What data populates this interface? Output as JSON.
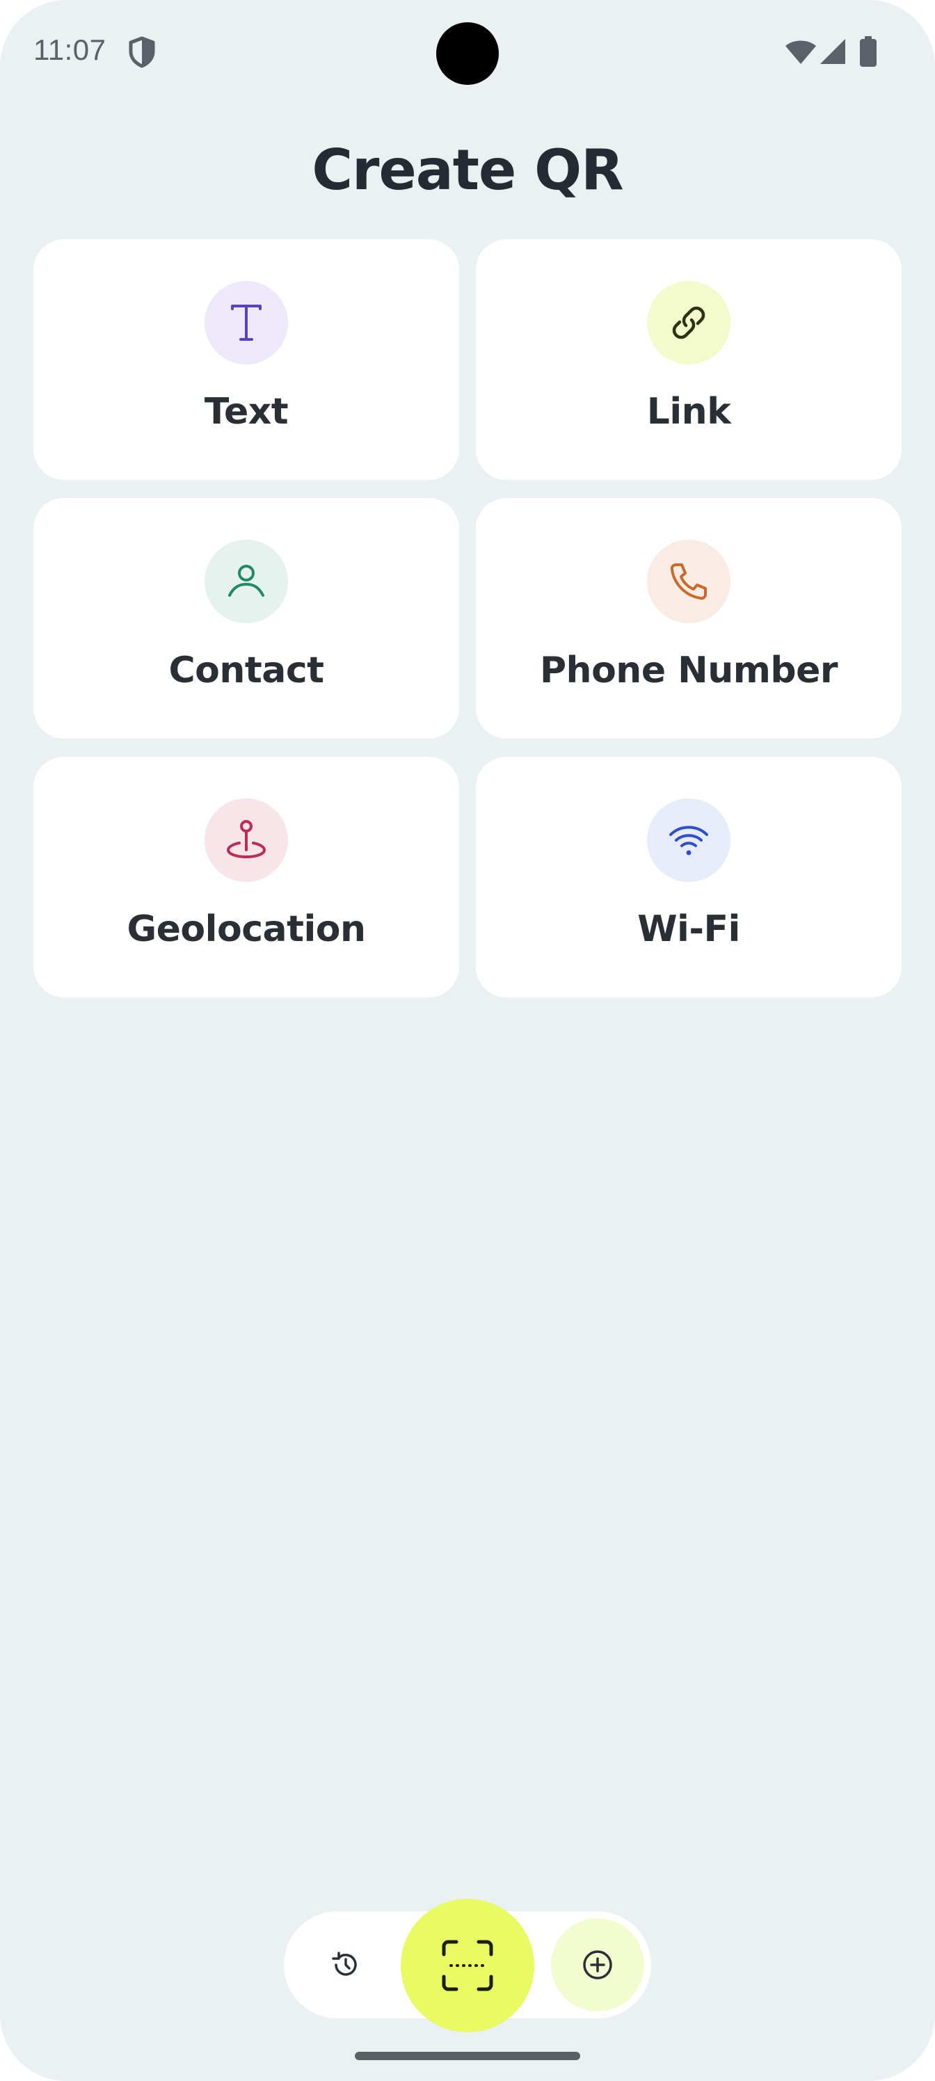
{
  "status_bar": {
    "time": "11:07",
    "icons": [
      "shield-icon",
      "wifi-icon",
      "signal-icon",
      "battery-icon"
    ]
  },
  "header": {
    "title": "Create QR"
  },
  "options": [
    {
      "label": "Text",
      "icon": "text-icon",
      "icon_color": "#5b3fc4",
      "icon_bg": "#ede9f8"
    },
    {
      "label": "Link",
      "icon": "link-icon",
      "icon_color": "#2b3312",
      "icon_bg": "#f3fbcd"
    },
    {
      "label": "Contact",
      "icon": "contact-icon",
      "icon_color": "#1f8a63",
      "icon_bg": "#e6f2ee"
    },
    {
      "label": "Phone Number",
      "icon": "phone-icon",
      "icon_color": "#c96a2a",
      "icon_bg": "#f8ece4"
    },
    {
      "label": "Geolocation",
      "icon": "geolocation-icon",
      "icon_color": "#c02a5a",
      "icon_bg": "#f7e5ea"
    },
    {
      "label": "Wi-Fi",
      "icon": "wifi-icon",
      "icon_color": "#2c4fd2",
      "icon_bg": "#e8ecf8"
    }
  ],
  "bottom_nav": {
    "items": [
      "history-icon",
      "scan-icon",
      "create-icon"
    ],
    "scan_color": "#e9fb63",
    "active_tab_bg": "#f3fbd0"
  },
  "theme": {
    "background": "#ebf0f3",
    "card": "#ffffff",
    "text": "#252b33"
  }
}
